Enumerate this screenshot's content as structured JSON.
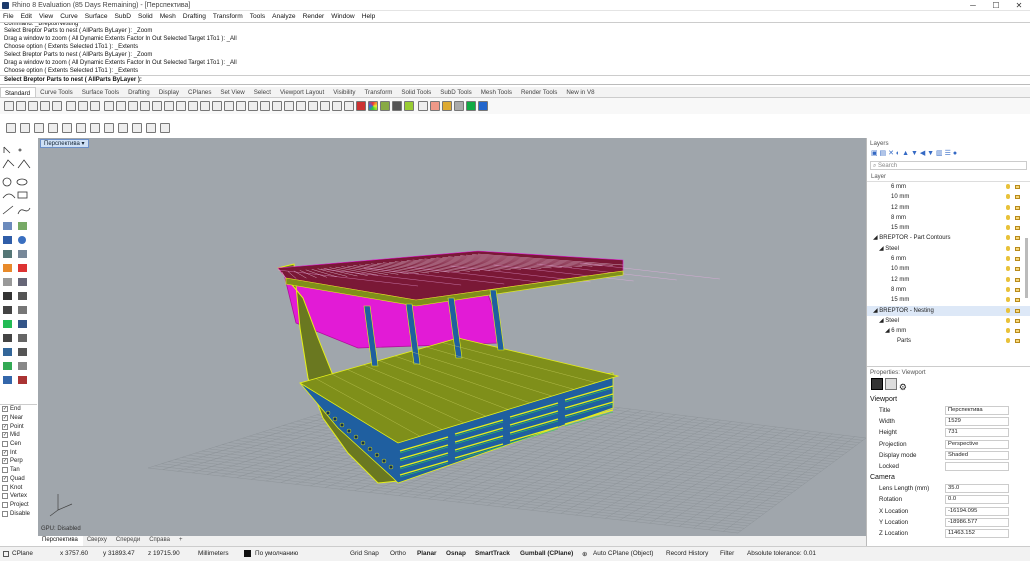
{
  "window": {
    "title": "Rhino 8 Evaluation (85 Days Remaining) - [Перспектива]",
    "min_glyph": "─",
    "max_glyph": "☐",
    "close_glyph": "✕"
  },
  "menu": [
    "File",
    "Edit",
    "View",
    "Curve",
    "Surface",
    "SubD",
    "Solid",
    "Mesh",
    "Drafting",
    "Transform",
    "Tools",
    "Analyze",
    "Render",
    "Window",
    "Help"
  ],
  "command_history": [
    "Command: _BreptorNesting",
    "Select Breptor Parts to nest ( AllParts  ByLayer ): _Zoom",
    "Drag a window to zoom ( All  Dynamic  Extents  Factor  In  Out  Selected  Target  1To1 ): _All",
    "Choose option ( Extents  Selected  1To1 ): _Extents",
    "Select Breptor Parts to nest ( AllParts  ByLayer ): _Zoom",
    "Drag a window to zoom ( All  Dynamic  Extents  Factor  In  Out  Selected  Target  1To1 ): _All",
    "Choose option ( Extents  Selected  1To1 ): _Extents"
  ],
  "command_prompt": "Select Breptor Parts to nest ( AllParts  ByLayer ):",
  "toolbar_tabs": [
    "Standard",
    "Curve Tools",
    "Surface Tools",
    "Solid Tools",
    "SubD Tools",
    "Mesh Tools",
    "Render Tools",
    "Drafting",
    "Display",
    "CPlanes",
    "Set View",
    "Select",
    "Viewport Layout",
    "Visibility",
    "Transform",
    "New in V8"
  ],
  "toolbar_tabs_ordered": [
    "Standard",
    "Curve Tools",
    "Surface Tools",
    "Drafting",
    "Display",
    "CPlanes",
    "Set View",
    "Select",
    "Viewport Layout",
    "Visibility",
    "Transform",
    "Solid Tools",
    "SubD Tools",
    "Mesh Tools",
    "Render Tools",
    "New in V8"
  ],
  "active_toolbar_tab": "Standard",
  "viewport": {
    "title": "Перспектива",
    "gpu_label": "GPU: Disabled",
    "background": "#a0a6ac"
  },
  "viewport_tabs": [
    "Перспектива",
    "Сверху",
    "Спереди",
    "Справа"
  ],
  "active_viewport_tab": "Перспектива",
  "osnaps": [
    {
      "label": "End",
      "checked": true
    },
    {
      "label": "Near",
      "checked": true
    },
    {
      "label": "Point",
      "checked": true
    },
    {
      "label": "Mid",
      "checked": true
    },
    {
      "label": "Cen",
      "checked": false
    },
    {
      "label": "Int",
      "checked": true
    },
    {
      "label": "Perp",
      "checked": true
    },
    {
      "label": "Tan",
      "checked": false
    },
    {
      "label": "Quad",
      "checked": true
    },
    {
      "label": "Knot",
      "checked": false
    },
    {
      "label": "Vertex",
      "checked": false
    },
    {
      "label": "Project",
      "checked": false
    },
    {
      "label": "Disable",
      "checked": false
    }
  ],
  "layers_panel": {
    "title": "Layers",
    "search_placeholder": "Search",
    "column_header": "Layer",
    "rows": [
      {
        "label": "6 mm",
        "indent": 3,
        "selected": false
      },
      {
        "label": "10 mm",
        "indent": 3,
        "selected": false
      },
      {
        "label": "12 mm",
        "indent": 3,
        "selected": false
      },
      {
        "label": "8 mm",
        "indent": 3,
        "selected": false
      },
      {
        "label": "15 mm",
        "indent": 3,
        "selected": false
      },
      {
        "label": "◢ BREPTOR - Part Contours",
        "indent": 0,
        "selected": false
      },
      {
        "label": "◢ Steel",
        "indent": 1,
        "selected": false
      },
      {
        "label": "6 mm",
        "indent": 3,
        "selected": false
      },
      {
        "label": "10 mm",
        "indent": 3,
        "selected": false
      },
      {
        "label": "12 mm",
        "indent": 3,
        "selected": false
      },
      {
        "label": "8 mm",
        "indent": 3,
        "selected": false
      },
      {
        "label": "15 mm",
        "indent": 3,
        "selected": false
      },
      {
        "label": "◢ BREPTOR - Nesting",
        "indent": 0,
        "selected": true
      },
      {
        "label": "◢ Steel",
        "indent": 1,
        "selected": false
      },
      {
        "label": "◢ 6 mm",
        "indent": 2,
        "selected": false
      },
      {
        "label": "Parts",
        "indent": 4,
        "selected": false
      }
    ]
  },
  "properties_panel": {
    "title": "Properties: Viewport",
    "viewport_section": "Viewport",
    "viewport_rows": [
      {
        "key": "Title",
        "value": "Перспектива"
      },
      {
        "key": "Width",
        "value": "1529"
      },
      {
        "key": "Height",
        "value": "731"
      },
      {
        "key": "Projection",
        "value": "Perspective"
      },
      {
        "key": "Display mode",
        "value": "Shaded"
      },
      {
        "key": "Locked",
        "value": ""
      }
    ],
    "camera_section": "Camera",
    "camera_rows": [
      {
        "key": "Lens Length (mm)",
        "value": "35.0"
      },
      {
        "key": "Rotation",
        "value": "0.0"
      },
      {
        "key": "X Location",
        "value": "-16194.095"
      },
      {
        "key": "Y Location",
        "value": "-18986.577"
      },
      {
        "key": "Z Location",
        "value": "11463.152"
      }
    ]
  },
  "status_bar": {
    "cplane": "CPlane",
    "x": "x 3757.60",
    "y": "y 31893.47",
    "z": "z 19715.90",
    "units": "Millimeters",
    "layer": "По умолчанию",
    "grid_snap": "Grid Snap",
    "ortho": "Ortho",
    "planar": "Planar",
    "osnap": "Osnap",
    "smarttrack": "SmartTrack",
    "gumball": "Gumball (CPlane)",
    "auto_cplane": "Auto CPlane (Object)",
    "record_history": "Record History",
    "filter": "Filter",
    "tolerance": "Absolute tolerance: 0.01"
  },
  "colors": {
    "model_magenta": "#e21bd6",
    "model_olive": "#7f8f1a",
    "model_blue": "#1f5fa0",
    "model_yellow": "#e6f018",
    "model_green": "#2fd84a",
    "model_maroon": "#7a1836"
  }
}
